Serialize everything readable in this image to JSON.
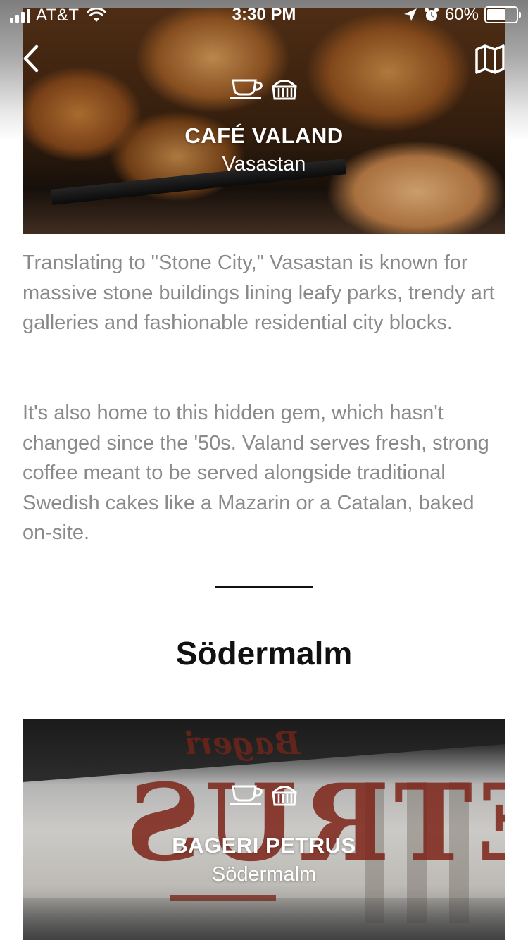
{
  "status_bar": {
    "carrier": "AT&T",
    "time": "3:30 PM",
    "battery_percent": "60%",
    "battery_level": 0.6,
    "icons": [
      "signal-icon",
      "wifi-icon",
      "location-arrow-icon",
      "alarm-icon",
      "battery-icon"
    ]
  },
  "nav": {
    "back_icon": "chevron-left-icon",
    "map_icon": "map-icon"
  },
  "places": [
    {
      "name": "CAFÉ VALAND",
      "neighborhood": "Vasastan",
      "icons": [
        "coffee-cup-icon",
        "pastry-basket-icon"
      ]
    },
    {
      "name": "BAGERI PETRUS",
      "neighborhood": "Södermalm",
      "icons": [
        "coffee-cup-icon",
        "pastry-basket-icon"
      ]
    }
  ],
  "description": {
    "paragraph1": "Translating to \"Stone City,\" Vasastan is known for massive stone buildings lining leafy parks, trendy art galleries and fashionable residential city blocks.",
    "paragraph2": "It's also home to this hidden gem, which hasn't changed since the '50s. Valand serves fresh, strong coffee meant to be served alongside traditional Swedish cakes like a Mazarin or a Catalan, baked on-site."
  },
  "section": {
    "heading": "Södermalm"
  },
  "photo_text": {
    "storefront_sign": "PETRUS",
    "storefront_small": "Bageri"
  }
}
